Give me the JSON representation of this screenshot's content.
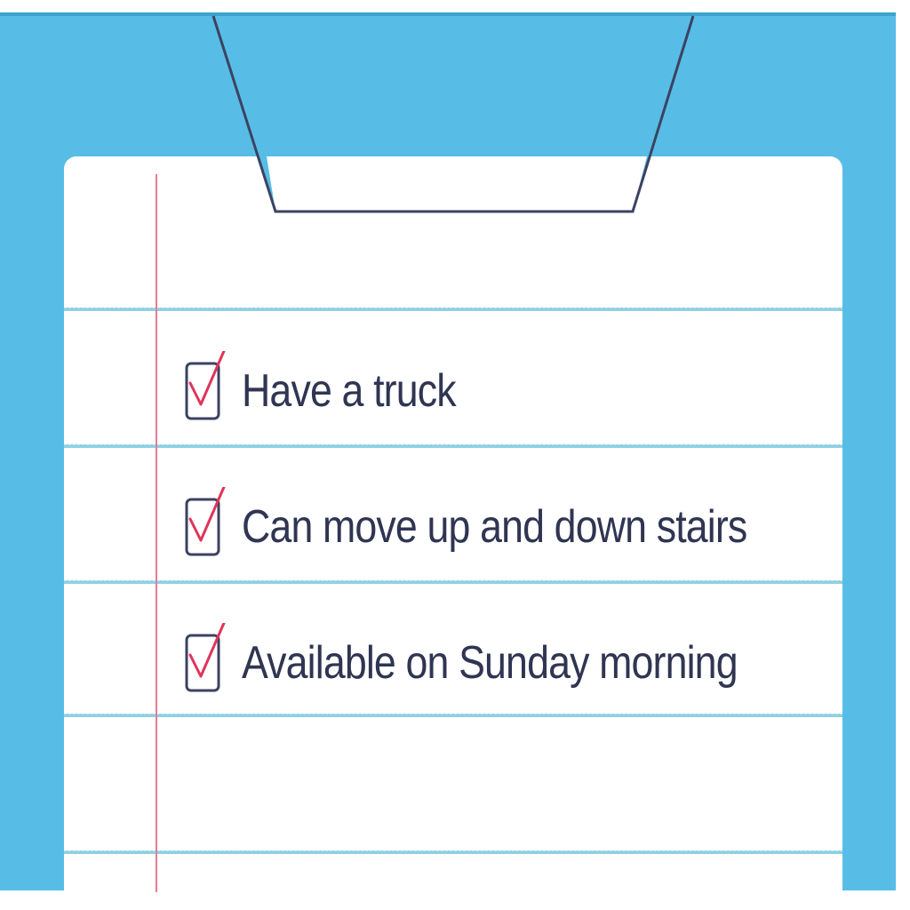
{
  "checklist": {
    "items": [
      {
        "label": "Have a truck",
        "checked": true
      },
      {
        "label": "Can move up and down stairs",
        "checked": true
      },
      {
        "label": "Available on Sunday morning",
        "checked": true
      }
    ]
  },
  "colors": {
    "board": "#57bde6",
    "paper": "#ffffff",
    "rule": "#8fd0e3",
    "margin": "#e77b91",
    "check": "#e0345a",
    "text": "#2f3552"
  },
  "icons": [
    "clipboard-clip-icon",
    "checkbox-checked-icon"
  ]
}
